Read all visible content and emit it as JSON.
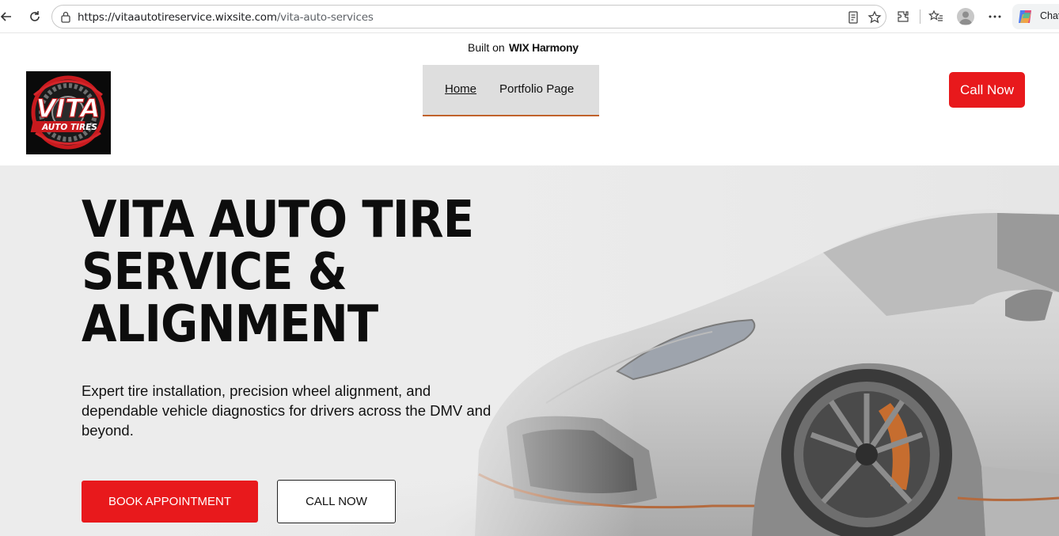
{
  "browser": {
    "url_host": "https://vitaautotireservice.wixsite.com",
    "url_path": "/vita-auto-services",
    "chat_label": "Chat",
    "icons": [
      "back-icon",
      "refresh-icon",
      "lock-icon",
      "reader-icon",
      "favorite-star-icon",
      "extensions-icon",
      "favorites-list-icon",
      "profile-icon",
      "more-icon",
      "copilot-icon"
    ]
  },
  "wix_banner": {
    "built_on": "Built on",
    "brand": "WIX Harmony"
  },
  "header": {
    "logo": {
      "line1": "VITA",
      "line2": "AUTO TIRES"
    },
    "menu": [
      {
        "label": "Home",
        "active": true
      },
      {
        "label": "Portfolio Page",
        "active": false
      }
    ],
    "call_button": "Call Now"
  },
  "hero": {
    "title_lines": [
      "VITA AUTO TIRE",
      "SERVICE &",
      "ALIGNMENT"
    ],
    "subtitle": "Expert tire installation, precision wheel alignment, and dependable vehicle diagnostics for drivers across the DMV and beyond.",
    "primary_button": "BOOK APPOINTMENT",
    "secondary_button": "CALL NOW"
  },
  "colors": {
    "accent_red": "#e8191c",
    "menu_bg": "#dedede",
    "menu_underline": "#c0622b",
    "hero_bg": "#ececec"
  }
}
